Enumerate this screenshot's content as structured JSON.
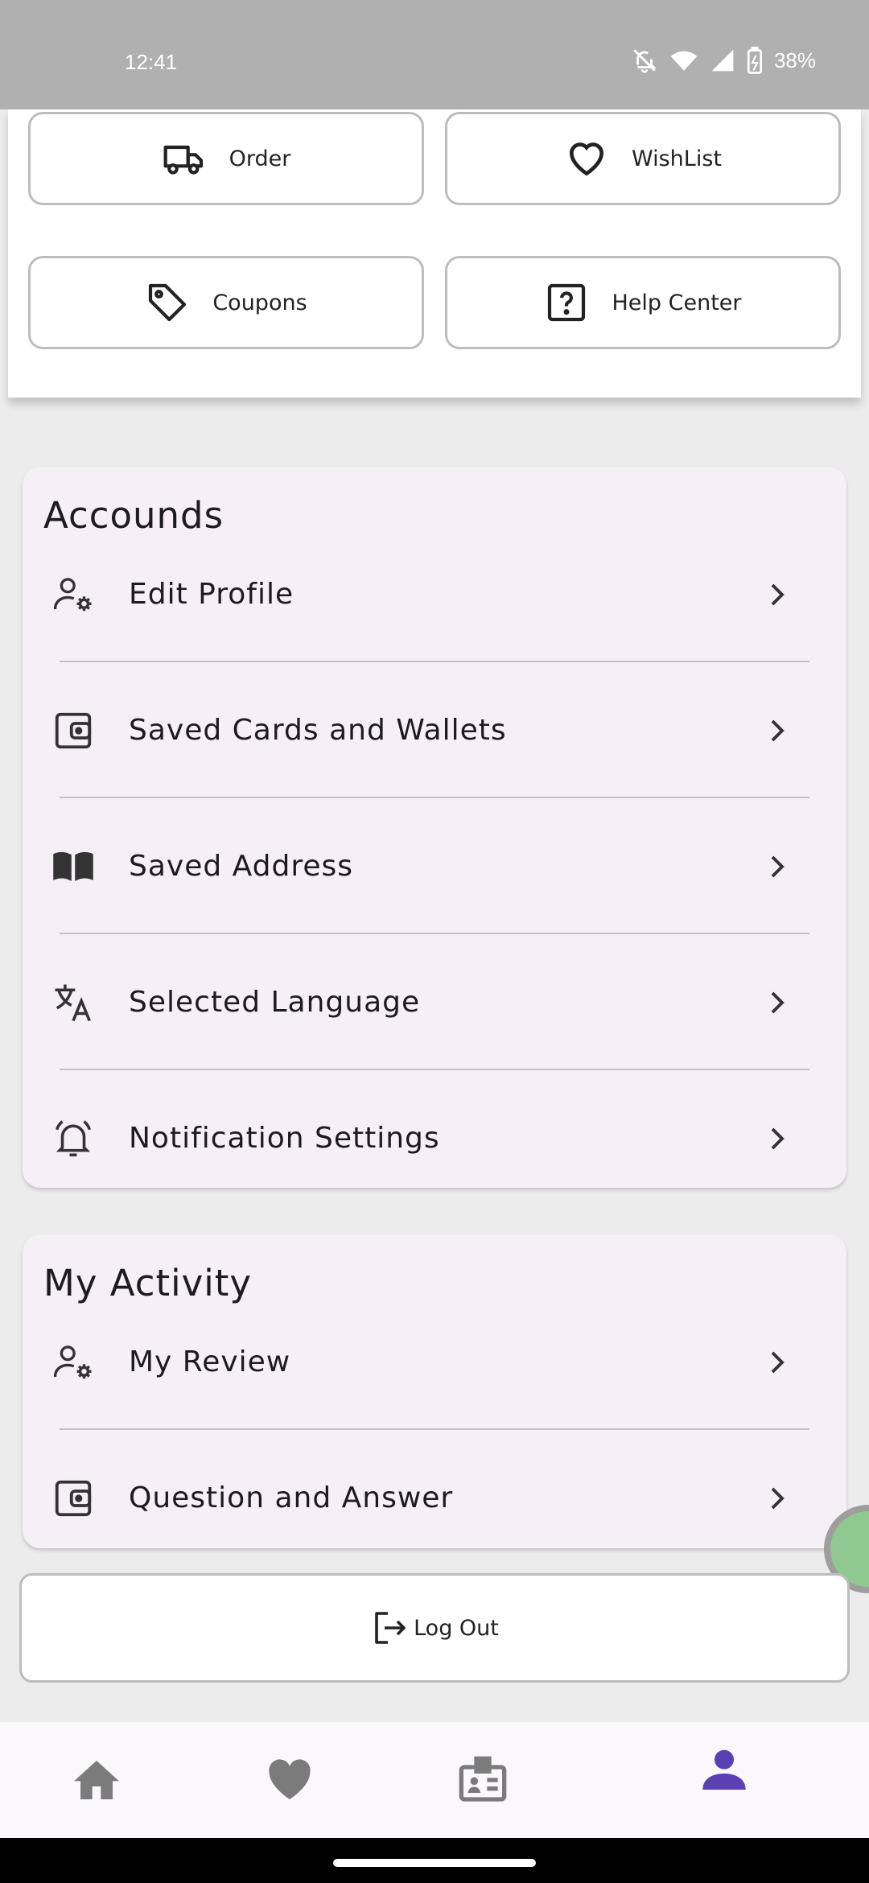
{
  "status_bar": {
    "time": "12:41",
    "battery": "38%"
  },
  "quick_actions": {
    "order": {
      "label": "Order",
      "icon": "truck-icon"
    },
    "wishlist": {
      "label": "WishList",
      "icon": "heart-outline-icon"
    },
    "coupons": {
      "label": "Coupons",
      "icon": "tag-icon"
    },
    "help_center": {
      "label": "Help Center",
      "icon": "help-box-icon"
    }
  },
  "accounts": {
    "title": "Accounds",
    "items": [
      {
        "label": "Edit Profile",
        "icon": "user-gear-icon"
      },
      {
        "label": "Saved Cards and Wallets",
        "icon": "wallet-icon"
      },
      {
        "label": "Saved Address",
        "icon": "open-book-icon"
      },
      {
        "label": "Selected Language",
        "icon": "translate-icon"
      },
      {
        "label": "Notification Settings",
        "icon": "alarm-bell-icon"
      }
    ]
  },
  "activity": {
    "title": "My  Activity",
    "items": [
      {
        "label": "My Review",
        "icon": "user-gear-icon"
      },
      {
        "label": "Question and Answer",
        "icon": "wallet-icon"
      }
    ]
  },
  "logout": {
    "label": "Log Out",
    "icon": "logout-icon"
  },
  "bottom_nav": {
    "items": [
      "home-icon",
      "heart-icon",
      "id-badge-icon",
      "person-icon"
    ],
    "active": "person-icon",
    "active_color": "#5b3fb3",
    "inactive_color": "#7b7b7b"
  },
  "colors": {
    "section_bg": "#f4f0f5",
    "page_bg": "#ececec"
  }
}
